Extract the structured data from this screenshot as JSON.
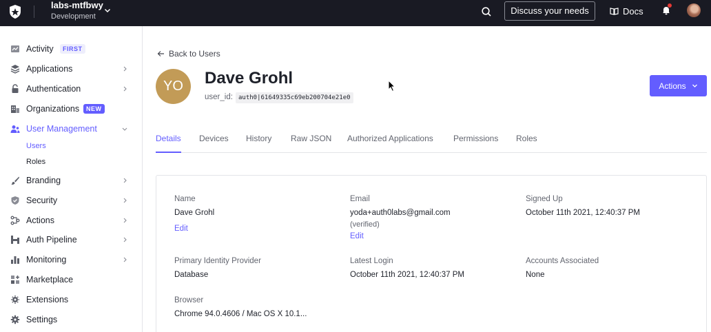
{
  "topbar": {
    "tenant_name": "labs-mtfbwy",
    "tenant_env": "Development",
    "discuss_label": "Discuss your needs",
    "docs_label": "Docs"
  },
  "sidebar": {
    "items": [
      {
        "label": "Activity",
        "icon": "activity-icon",
        "badge": "FIRST"
      },
      {
        "label": "Applications",
        "icon": "layers-icon"
      },
      {
        "label": "Authentication",
        "icon": "lock-icon"
      },
      {
        "label": "Organizations",
        "icon": "building-icon",
        "badge": "NEW"
      },
      {
        "label": "User Management",
        "icon": "users-icon"
      },
      {
        "label": "Branding",
        "icon": "brush-icon"
      },
      {
        "label": "Security",
        "icon": "shield-icon"
      },
      {
        "label": "Actions",
        "icon": "flow-icon"
      },
      {
        "label": "Auth Pipeline",
        "icon": "pipeline-icon"
      },
      {
        "label": "Monitoring",
        "icon": "bar-chart-icon"
      },
      {
        "label": "Marketplace",
        "icon": "grid-plus-icon"
      },
      {
        "label": "Extensions",
        "icon": "puzzle-icon"
      },
      {
        "label": "Settings",
        "icon": "gear-icon"
      }
    ],
    "sub_items": [
      "Users",
      "Roles"
    ]
  },
  "back_label": "Back to Users",
  "profile": {
    "initials": "YO",
    "name": "Dave Grohl",
    "user_id_label": "user_id:",
    "user_id": "auth0|61649335c69eb200704e21e0"
  },
  "actions_label": "Actions",
  "tabs": [
    "Details",
    "Devices",
    "History",
    "Raw JSON",
    "Authorized Applications",
    "Permissions",
    "Roles"
  ],
  "details": {
    "name_label": "Name",
    "name_value": "Dave Grohl",
    "edit_label": "Edit",
    "email_label": "Email",
    "email_value": "yoda+auth0labs@gmail.com",
    "email_note": "(verified)",
    "signed_up_label": "Signed Up",
    "signed_up_value": "October 11th 2021, 12:40:37 PM",
    "idp_label": "Primary Identity Provider",
    "idp_value": "Database",
    "last_login_label": "Latest Login",
    "last_login_value": "October 11th 2021, 12:40:37 PM",
    "accounts_label": "Accounts Associated",
    "accounts_value": "None",
    "browser_label": "Browser",
    "browser_value": "Chrome 94.0.4606 / Mac OS X 10.1..."
  },
  "colors": {
    "accent": "#635dff",
    "topbar": "#191a23",
    "avatar": "#c29b57"
  }
}
